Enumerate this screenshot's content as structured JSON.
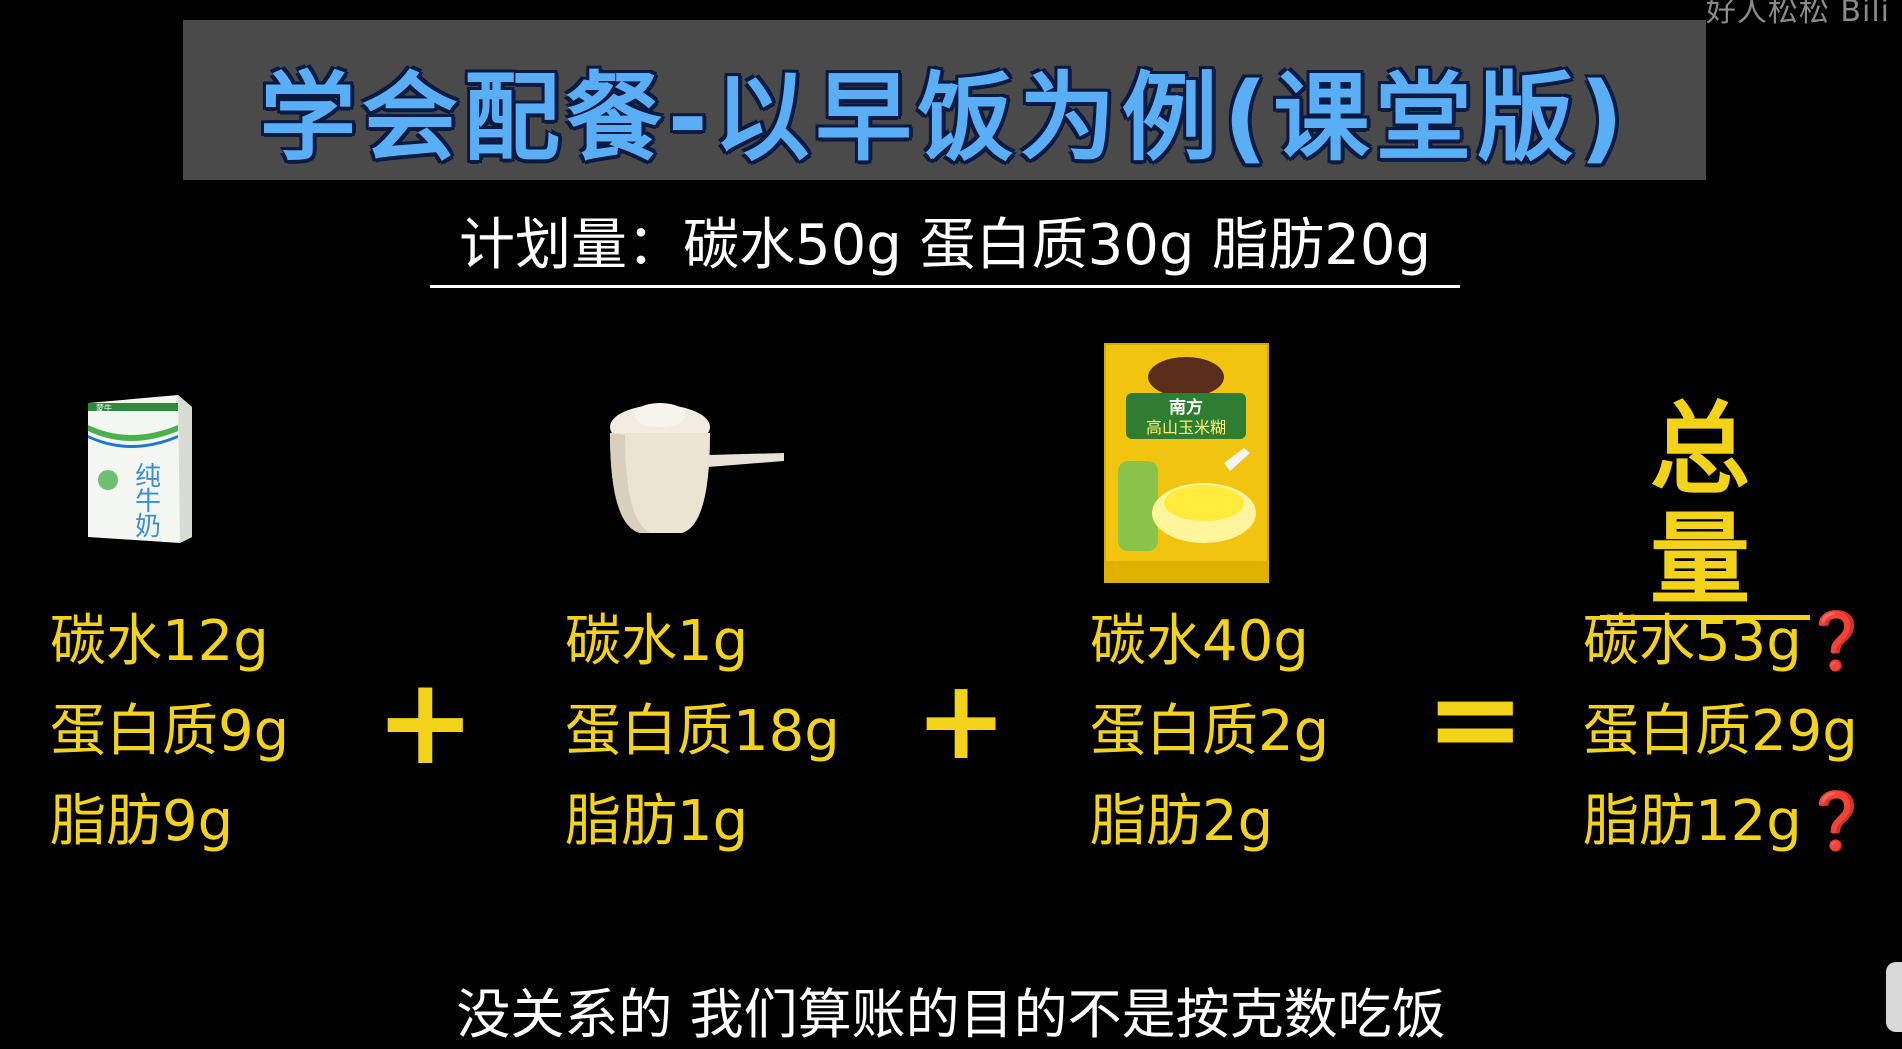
{
  "watermark": "好人松松 Bili",
  "title": "学会配餐-以早饭为例(课堂版)",
  "plan": "计划量：碳水50g 蛋白质30g 脂肪20g",
  "foods": [
    {
      "icon": "milk-carton-icon",
      "brand": "蒙牛",
      "label": "纯牛奶",
      "carb": "碳水12g",
      "protein": "蛋白质9g",
      "fat": "脂肪9g"
    },
    {
      "icon": "protein-powder-scoop-icon",
      "carb": "碳水1g",
      "protein": "蛋白质18g",
      "fat": "脂肪1g"
    },
    {
      "icon": "corn-paste-bag-icon",
      "brand": "南方",
      "label": "高山玉米糊",
      "carb": "碳水40g",
      "protein": "蛋白质2g",
      "fat": "脂肪2g"
    }
  ],
  "operators": {
    "plus1": "+",
    "plus2": "+",
    "equals": "="
  },
  "total": {
    "title": "总量",
    "carb": "碳水53g",
    "protein": "蛋白质29g",
    "fat": "脂肪12g",
    "mark": "❓"
  },
  "subtitle": "没关系的 我们算账的目的不是按克数吃饭",
  "colors": {
    "title": "#5aaef5",
    "highlight": "#f3d21a",
    "question": "#e01010"
  }
}
